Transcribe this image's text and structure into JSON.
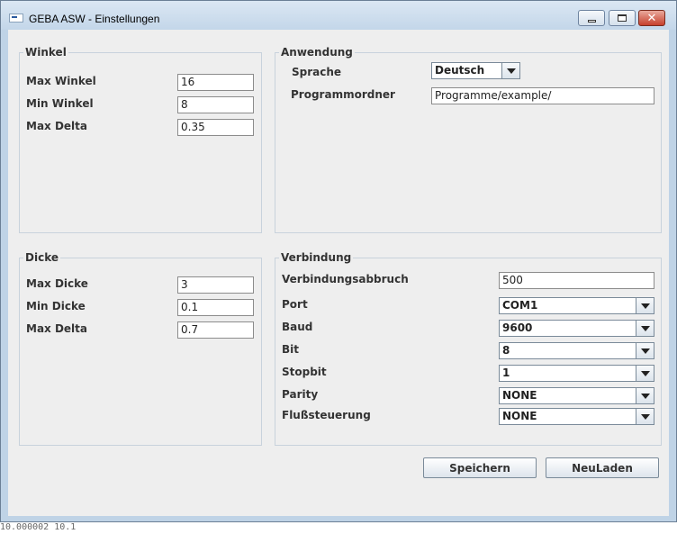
{
  "window": {
    "title": "GEBA ASW - Einstellungen"
  },
  "winkel": {
    "legend": "Winkel",
    "max_winkel": {
      "label": "Max Winkel",
      "value": "16"
    },
    "min_winkel": {
      "label": "Min Winkel",
      "value": "8"
    },
    "max_delta": {
      "label": "Max Delta",
      "value": "0.35"
    }
  },
  "dicke": {
    "legend": "Dicke",
    "max_dicke": {
      "label": "Max Dicke",
      "value": "3"
    },
    "min_dicke": {
      "label": "Min Dicke",
      "value": "0.1"
    },
    "max_delta": {
      "label": "Max Delta",
      "value": "0.7"
    }
  },
  "anwendung": {
    "legend": "Anwendung",
    "sprache": {
      "label": "Sprache",
      "value": "Deutsch"
    },
    "programmordner": {
      "label": "Programmordner",
      "value": "Programme/example/"
    }
  },
  "verbindung": {
    "legend": "Verbindung",
    "verbindungsabbruch": {
      "label": "Verbindungsabbruch",
      "value": "500"
    },
    "port": {
      "label": "Port",
      "value": "COM1"
    },
    "baud": {
      "label": "Baud",
      "value": "9600"
    },
    "bit": {
      "label": "Bit",
      "value": "8"
    },
    "stopbit": {
      "label": "Stopbit",
      "value": "1"
    },
    "parity": {
      "label": "Parity",
      "value": "NONE"
    },
    "flusssteuerung": {
      "label": "Flußsteuerung",
      "value": "NONE"
    }
  },
  "buttons": {
    "save": "Speichern",
    "reload": "NeuLaden"
  },
  "background_text": "10.000002 10.1"
}
